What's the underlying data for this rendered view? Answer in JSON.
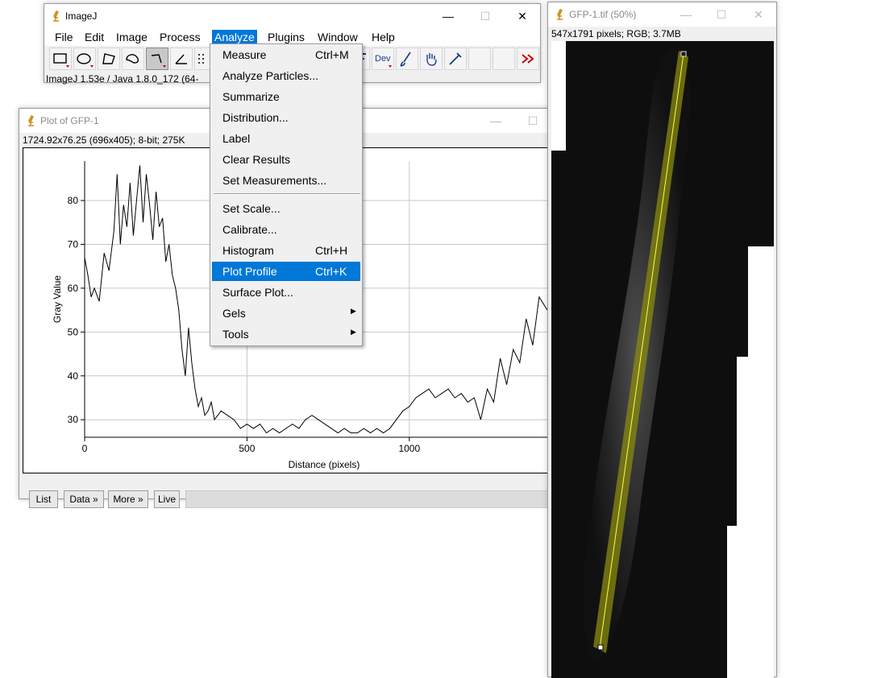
{
  "imagej": {
    "title": "ImageJ",
    "menus": [
      "File",
      "Edit",
      "Image",
      "Process",
      "Analyze",
      "Plugins",
      "Window",
      "Help"
    ],
    "active_menu": "Analyze",
    "status": "ImageJ 1.53e / Java 1.8.0_172 (64-",
    "dev_label": "Dev"
  },
  "analyze_menu": {
    "items": [
      {
        "label": "Measure",
        "shortcut": "Ctrl+M"
      },
      {
        "label": "Analyze Particles...",
        "shortcut": ""
      },
      {
        "label": "Summarize",
        "shortcut": ""
      },
      {
        "label": "Distribution...",
        "shortcut": ""
      },
      {
        "label": "Label",
        "shortcut": ""
      },
      {
        "label": "Clear Results",
        "shortcut": ""
      },
      {
        "label": "Set Measurements...",
        "shortcut": ""
      },
      {
        "label": "Set Scale...",
        "shortcut": ""
      },
      {
        "label": "Calibrate...",
        "shortcut": ""
      },
      {
        "label": "Histogram",
        "shortcut": "Ctrl+H"
      },
      {
        "label": "Plot Profile",
        "shortcut": "Ctrl+K",
        "highlighted": true
      },
      {
        "label": "Surface Plot...",
        "shortcut": ""
      },
      {
        "label": "Gels",
        "submenu": true
      },
      {
        "label": "Tools",
        "submenu": true
      }
    ]
  },
  "plot_window": {
    "title": "Plot of GFP-1",
    "info": "1724.92x76.25   (696x405); 8-bit; 275K",
    "buttons": [
      "List",
      "Data »",
      "More »",
      "Live"
    ]
  },
  "chart_data": {
    "type": "line",
    "title": "",
    "xlabel": "Distance (pixels)",
    "ylabel": "Gray Value",
    "xlim": [
      0,
      1425
    ],
    "ylim": [
      26,
      89
    ],
    "xticks": [
      0,
      500,
      1000
    ],
    "yticks": [
      30,
      40,
      50,
      60,
      70,
      80
    ],
    "grid": true,
    "series": [
      {
        "x": [
          0,
          10,
          20,
          30,
          45,
          60,
          75,
          90,
          100,
          110,
          120,
          130,
          140,
          150,
          160,
          170,
          180,
          190,
          200,
          210,
          220,
          230,
          240,
          250,
          260,
          270,
          280,
          290,
          300,
          310,
          320,
          330,
          340,
          350,
          360,
          370,
          380,
          390,
          400,
          420,
          440,
          460,
          480,
          500,
          520,
          540,
          560,
          580,
          600,
          620,
          640,
          660,
          680,
          700,
          720,
          740,
          760,
          780,
          800,
          820,
          840,
          860,
          880,
          900,
          920,
          940,
          960,
          980,
          1000,
          1020,
          1040,
          1060,
          1080,
          1100,
          1120,
          1140,
          1160,
          1180,
          1200,
          1220,
          1240,
          1260,
          1280,
          1300,
          1320,
          1340,
          1360,
          1380,
          1400,
          1425
        ],
        "y": [
          67,
          63,
          58,
          60,
          57,
          68,
          64,
          73,
          86,
          70,
          79,
          74,
          84,
          72,
          80,
          88,
          75,
          86,
          79,
          71,
          82,
          74,
          76,
          66,
          70,
          63,
          60,
          55,
          46,
          40,
          51,
          43,
          37,
          33,
          35,
          31,
          32,
          34,
          30,
          32,
          31,
          30,
          28,
          29,
          28,
          29,
          27,
          28,
          27,
          28,
          29,
          28,
          30,
          31,
          30,
          29,
          28,
          27,
          28,
          27,
          27,
          28,
          27,
          28,
          27,
          28,
          30,
          32,
          33,
          35,
          36,
          37,
          35,
          36,
          37,
          35,
          36,
          34,
          35,
          30,
          37,
          34,
          44,
          38,
          46,
          43,
          53,
          47,
          58,
          55
        ]
      }
    ]
  },
  "gfp_window": {
    "title": "GFP-1.tif (50%)",
    "info": "547x1791 pixels; RGB; 3.7MB"
  }
}
